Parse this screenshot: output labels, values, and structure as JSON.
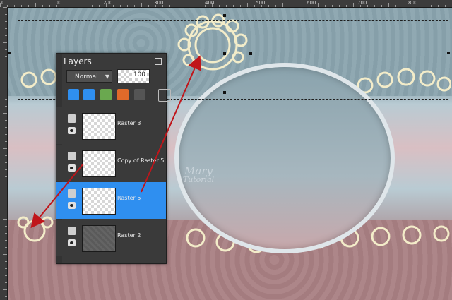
{
  "ruler": {
    "labels": [
      "0",
      "100",
      "200",
      "300",
      "400",
      "500",
      "600",
      "700",
      "800",
      "900"
    ]
  },
  "layers_panel": {
    "title": "Layers",
    "blend_mode": "Normal",
    "opacity": "100",
    "layers": [
      {
        "name": "Raster 3",
        "selected": false,
        "thumb": "checker"
      },
      {
        "name": "Copy of Raster 5",
        "selected": false,
        "thumb": "checker"
      },
      {
        "name": "Raster 5",
        "selected": true,
        "thumb": "checker"
      },
      {
        "name": "Raster 2",
        "selected": false,
        "thumb": "dark"
      }
    ],
    "toolbar_icons": [
      "move-up-icon",
      "move-down-icon",
      "new-layer-icon",
      "delete-layer-icon",
      "layer-properties-icon",
      "link-icon"
    ]
  },
  "watermark": {
    "line1": "Mary",
    "line2": "Tutorial"
  },
  "colors": {
    "selection_blue": "#2f8ff0",
    "arrow_red": "#c0151a",
    "panel_bg": "#3a3a3a"
  }
}
